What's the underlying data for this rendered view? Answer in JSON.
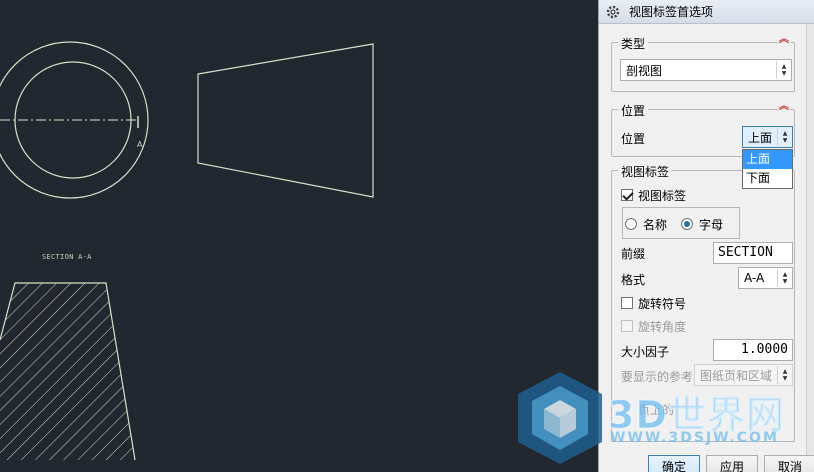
{
  "canvas": {
    "section_label": "SECTION A-A",
    "cut_mark": "A"
  },
  "panel": {
    "title": "视图标签首选项",
    "type_group": {
      "label": "类型",
      "value": "剖视图"
    },
    "position_group": {
      "label": "位置",
      "field_label": "位置",
      "value": "上面",
      "options": [
        "上面",
        "下面"
      ],
      "selected_option": "上面"
    },
    "view_label_group": {
      "label": "视图标签",
      "checkbox_label": "视图标签",
      "checkbox_checked": true,
      "radio_name": "名称",
      "radio_letter": "字母",
      "radio_selected": "字母",
      "prefix_label": "前缀",
      "prefix_value": "SECTION",
      "format_label": "格式",
      "format_value": "A-A",
      "rotate_symbol_label": "旋转符号",
      "rotate_angle_label": "旋转角度",
      "scale_label": "大小因子",
      "scale_value": "1.0000",
      "ref_label": "要显示的参考",
      "ref_value": "图纸页和区域",
      "partial_label": "页上的"
    },
    "buttons": {
      "ok": "确定",
      "apply": "应用",
      "cancel": "取消"
    }
  },
  "watermark": {
    "brand": "3D世界网",
    "url": "WWW.3DSJW.COM"
  },
  "colors": {
    "canvas_bg": "#212830",
    "line": "#d8e0c8",
    "accent_red": "#c0392b",
    "selection": "#3399ff"
  }
}
